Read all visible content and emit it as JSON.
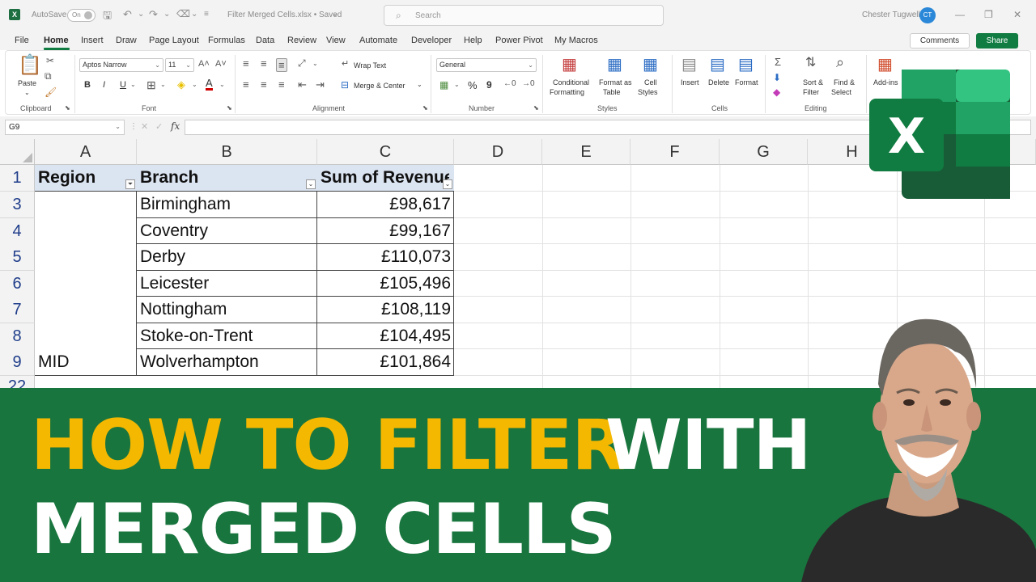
{
  "titlebar": {
    "autosave": "AutoSave",
    "toggle": "On",
    "filename": "Filter Merged Cells.xlsx • Saved",
    "search_placeholder": "Search",
    "user": "Chester Tugwell",
    "avatar": "CT"
  },
  "tabs": [
    "File",
    "Home",
    "Insert",
    "Draw",
    "Page Layout",
    "Formulas",
    "Data",
    "Review",
    "View",
    "Automate",
    "Developer",
    "Help",
    "Power Pivot",
    "My Macros"
  ],
  "buttons": {
    "comments": "Comments",
    "share": "Share"
  },
  "ribbon": {
    "clipboard": {
      "paste": "Paste",
      "group": "Clipboard"
    },
    "font": {
      "name": "Aptos Narrow",
      "size": "11",
      "group": "Font",
      "bold": "B",
      "italic": "I",
      "underline": "U"
    },
    "alignment": {
      "wrap": "Wrap Text",
      "merge": "Merge & Center",
      "group": "Alignment"
    },
    "number": {
      "format": "General",
      "group": "Number",
      "percent": "%",
      "comma": "9"
    },
    "styles": {
      "cond1": "Conditional",
      "cond2": "Formatting",
      "table1": "Format as",
      "table2": "Table",
      "cell1": "Cell",
      "cell2": "Styles",
      "group": "Styles"
    },
    "cells": {
      "insert": "Insert",
      "delete": "Delete",
      "format": "Format",
      "group": "Cells"
    },
    "editing": {
      "sort1": "Sort &",
      "sort2": "Filter",
      "find1": "Find &",
      "find2": "Select",
      "group": "Editing"
    },
    "addins": "Add-ins"
  },
  "formula_bar": {
    "cell_ref": "G9",
    "fx": "fx",
    "content": ""
  },
  "columns": [
    "A",
    "B",
    "C",
    "D",
    "E",
    "F",
    "G",
    "H"
  ],
  "rows": [
    "1",
    "3",
    "4",
    "5",
    "6",
    "7",
    "8",
    "9",
    "22"
  ],
  "table": {
    "headers": [
      "Region",
      "Branch",
      "Sum of Revenue"
    ],
    "region": "MID",
    "branches": [
      "Birmingham",
      "Coventry",
      "Derby",
      "Leicester",
      "Nottingham",
      "Stoke-on-Trent",
      "Wolverhampton"
    ],
    "revenues": [
      "£98,617",
      "£99,167",
      "£110,073",
      "£105,496",
      "£108,119",
      "£104,495",
      "£101,864"
    ]
  },
  "banner": {
    "line1_yellow": "HOW TO FILTER",
    "line1_white": "WITH",
    "line2": "MERGED CELLS"
  },
  "logo_letter": "X",
  "colors": {
    "excel_green": "#107c41",
    "banner_green": "#19753e",
    "yellow": "#f5b800",
    "header_blue": "#1f3d8a"
  }
}
